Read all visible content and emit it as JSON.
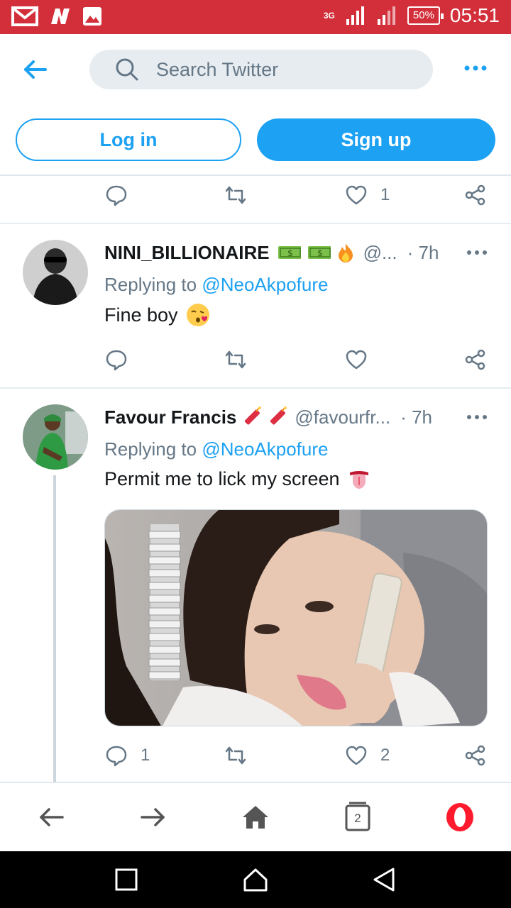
{
  "status_bar": {
    "time": "05:51",
    "battery": "50%",
    "network": "3G",
    "notification_icons": [
      "gmail-icon",
      "news-icon",
      "gallery-icon"
    ]
  },
  "header": {
    "search": {
      "placeholder": "Search Twitter"
    },
    "login_label": "Log in",
    "signup_label": "Sign up"
  },
  "colors": {
    "status_bar": "#d32f3a",
    "accent": "#1da1f2",
    "secondary_text": "#657786",
    "opera_red": "#ff1b2d"
  },
  "feed": {
    "partial_tweet": {
      "like_count": "1"
    },
    "tweets": [
      {
        "name": "NINI_BILLIONAIRE",
        "name_emojis": [
          "money-emoji",
          "money-emoji",
          "fire-emoji"
        ],
        "handle": "@...",
        "time": "· 7h",
        "replying_prefix": "Replying to",
        "replying_to": "@NeoAkpofure",
        "text": "Fine boy",
        "text_emoji": "kissing-face-emoji"
      },
      {
        "name": "Favour Francis",
        "name_emojis": [
          "firecracker-emoji",
          "firecracker-emoji"
        ],
        "handle": "@favourfr...",
        "time": "· 7h",
        "replying_prefix": "Replying to",
        "replying_to": "@NeoAkpofure",
        "text": "Permit me to lick my screen",
        "text_emoji": "tongue-emoji",
        "reply_count": "1",
        "like_count": "2"
      }
    ]
  },
  "browser_bar": {
    "tabs_count": "2"
  }
}
